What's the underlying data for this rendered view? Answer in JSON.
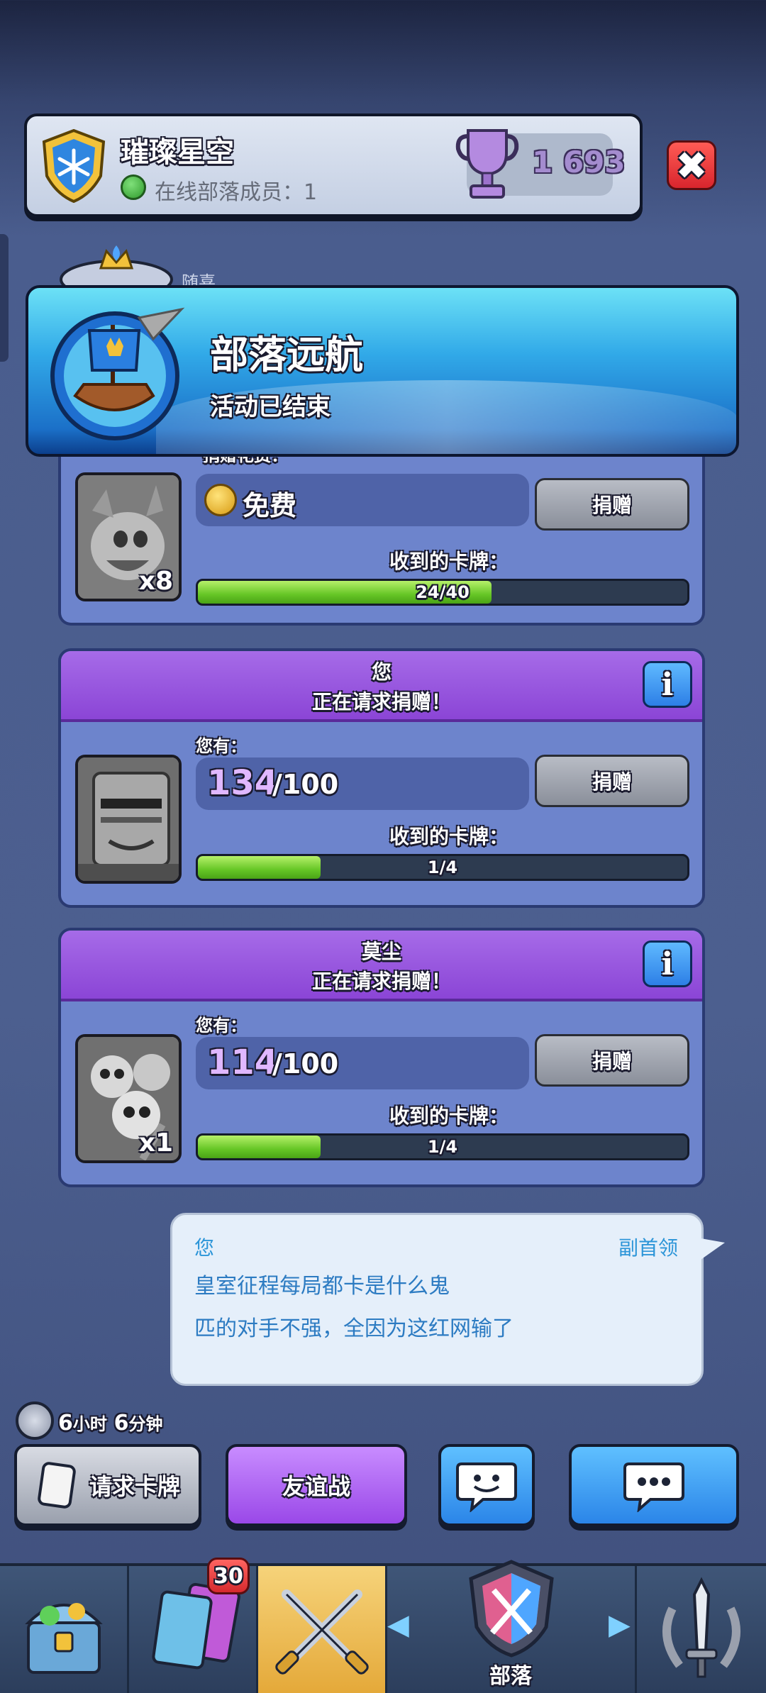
{
  "header": {
    "clan_name": "璀璨星空",
    "online_label": "在线部落成员：",
    "online_count": "1",
    "trophies": "1 693"
  },
  "behind_member": {
    "name": "随喜"
  },
  "banner": {
    "title": "部落远航",
    "subtitle": "活动已结束"
  },
  "requests": [
    {
      "cost_label": "捐赠花费：",
      "cost": "免费",
      "card_multiplier": "x8",
      "donate_label": "捐赠",
      "received_label": "收到的卡牌：",
      "progress_text": "24/40",
      "progress_value": 0.6
    },
    {
      "name": "您",
      "status": "正在请求捐赠！",
      "you_have_label": "您有：",
      "have": "134",
      "need": "/100",
      "donate_label": "捐赠",
      "received_label": "收到的卡牌：",
      "progress_text": "1/4",
      "progress_value": 0.25
    },
    {
      "name": "莫尘",
      "status": "正在请求捐赠！",
      "you_have_label": "您有：",
      "have": "114",
      "need": "/100",
      "card_multiplier": "x1",
      "donate_label": "捐赠",
      "received_label": "收到的卡牌：",
      "progress_text": "1/4",
      "progress_value": 0.25
    }
  ],
  "chat": {
    "sender": "您",
    "role": "副首领",
    "line1": "皇室征程每局都卡是什么鬼",
    "line2": "匹的对手不强，全因为这红网输了"
  },
  "timer": {
    "hours": "6",
    "hours_unit": "小时",
    "minutes": "6",
    "minutes_unit": "分钟"
  },
  "actions": {
    "request_cards": "请求卡牌",
    "friendly_battle": "友谊战"
  },
  "nav": {
    "cards_badge": "30",
    "clan_label": "部落"
  },
  "colors": {
    "purple_header": "#9a48e8",
    "blue_button": "#2b85e8",
    "progress_green": "#66c626",
    "close_red": "#d8252d"
  }
}
